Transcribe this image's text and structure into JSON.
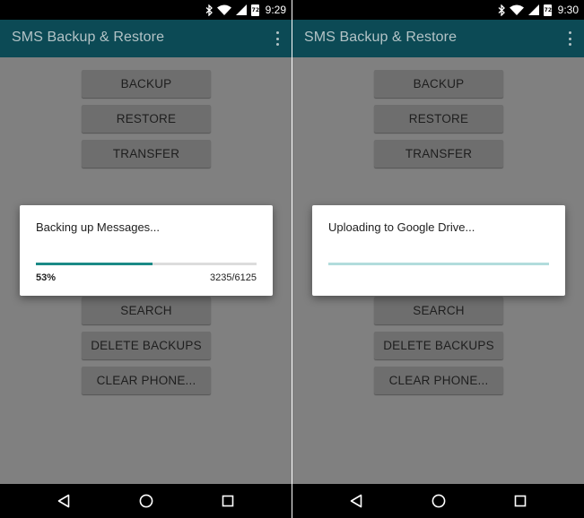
{
  "app_title": "SMS Backup & Restore",
  "icons": {
    "bluetooth": "bluetooth-icon",
    "wifi": "wifi-icon",
    "signal": "cell-signal-icon",
    "battery": "battery-icon",
    "overflow": "overflow-menu-icon",
    "back": "back-icon",
    "home": "home-icon",
    "recents": "recents-icon"
  },
  "colors": {
    "toolbar": "#0c4a55",
    "progress": "#1b8a86",
    "dim_overlay": "#808080"
  },
  "left": {
    "status": {
      "time": "9:29",
      "battery_level": "72"
    },
    "menu": {
      "backup": "BACKUP",
      "restore": "RESTORE",
      "transfer": "TRANSFER",
      "search": "SEARCH",
      "delete_backups": "DELETE BACKUPS",
      "clear_phone": "CLEAR PHONE..."
    },
    "dialog": {
      "message": "Backing up Messages...",
      "progress_fraction": 0.53,
      "percent_label": "53%",
      "count_label": "3235/6125"
    }
  },
  "right": {
    "status": {
      "time": "9:30",
      "battery_level": "72"
    },
    "menu": {
      "backup": "BACKUP",
      "restore": "RESTORE",
      "transfer": "TRANSFER",
      "search": "SEARCH",
      "delete_backups": "DELETE BACKUPS",
      "clear_phone": "CLEAR PHONE..."
    },
    "dialog": {
      "message": "Uploading to Google Drive..."
    }
  }
}
